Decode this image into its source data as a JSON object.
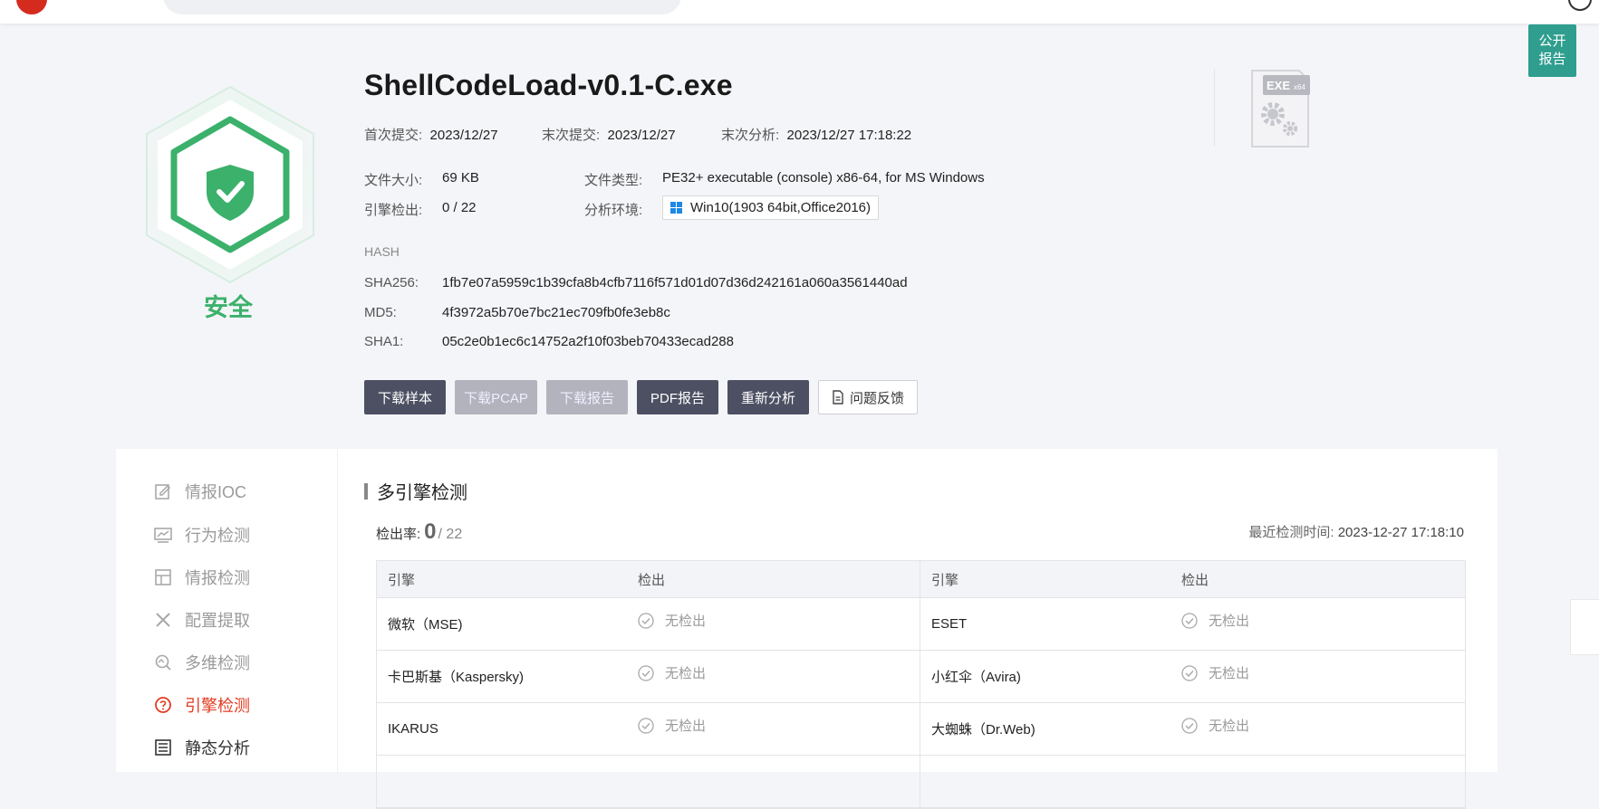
{
  "topbar": {
    "search_placeholder": ""
  },
  "public_report": {
    "line1": "公开",
    "line2": "报告"
  },
  "verdict": {
    "label": "安全",
    "color": "#3bb16b"
  },
  "file": {
    "name": "ShellCodeLoad-v0.1-C.exe",
    "first_submit_label": "首次提交:",
    "first_submit": "2023/12/27",
    "last_submit_label": "末次提交:",
    "last_submit": "2023/12/27",
    "last_analysis_label": "末次分析:",
    "last_analysis": "2023/12/27 17:18:22",
    "size_label": "文件大小:",
    "size": "69 KB",
    "type_label": "文件类型:",
    "type": "PE32+ executable (console) x86-64, for MS Windows",
    "engine_label": "引擎检出:",
    "engine": "0 / 22",
    "env_label": "分析环境:",
    "env": "Win10(1903 64bit,Office2016)",
    "icon_badge": "EXE",
    "icon_badge_sub": "x64"
  },
  "hash": {
    "heading": "HASH",
    "sha256_label": "SHA256:",
    "sha256": "1fb7e07a5959c1b39cfa8b4cfb7116f571d01d07d36d242161a060a3561440ad",
    "md5_label": "MD5:",
    "md5": "4f3972a5b70e7bc21ec709fb0fe3eb8c",
    "sha1_label": "SHA1:",
    "sha1": "05c2e0b1ec6c14752a2f10f03beb70433ecad288"
  },
  "actions": {
    "download_sample": "下载样本",
    "download_pcap": "下载PCAP",
    "download_report": "下载报告",
    "pdf_report": "PDF报告",
    "reanalyze": "重新分析",
    "feedback": "问题反馈"
  },
  "sidenav": {
    "items": [
      {
        "label": "情报IOC"
      },
      {
        "label": "行为检测"
      },
      {
        "label": "情报检测"
      },
      {
        "label": "配置提取"
      },
      {
        "label": "多维检测"
      },
      {
        "label": "引擎检测"
      },
      {
        "label": "静态分析"
      }
    ]
  },
  "engines": {
    "title": "多引擎检测",
    "rate_label": "检出率:",
    "rate_value": "0",
    "rate_total": "/ 22",
    "last_time_label": "最近检测时间:",
    "last_time": "2023-12-27 17:18:10",
    "headers": {
      "engine": "引擎",
      "detection": "检出"
    },
    "rows": [
      {
        "left": "微软（MSE)",
        "left_det": "无检出",
        "right": "ESET",
        "right_det": "无检出"
      },
      {
        "left": "卡巴斯基（Kaspersky)",
        "left_det": "无检出",
        "right": "小红伞（Avira)",
        "right_det": "无检出"
      },
      {
        "left": "IKARUS",
        "left_det": "无检出",
        "right": "大蜘蛛（Dr.Web)",
        "right_det": "无检出"
      }
    ]
  }
}
